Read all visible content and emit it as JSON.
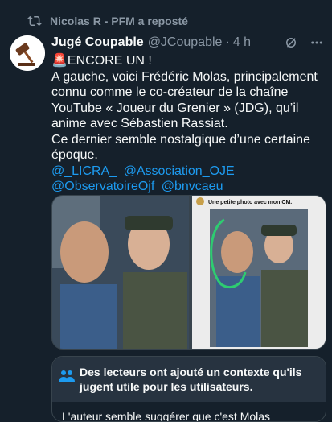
{
  "repost": {
    "text": "Nicolas R - PFM a reposté",
    "icon": "repost-icon"
  },
  "post": {
    "display_name": "Jugé Coupable",
    "handle": "@JCoupable",
    "time": "4 h",
    "siren_emoji": "🚨",
    "paragraph1": "ENCORE UN !",
    "paragraph2": "A gauche, voici Frédéric Molas, principalement connu comme le co-créateur de la chaîne YouTube « Joueur du Grenier » (JDG), qu’il anime avec Sébastien Rassiat.",
    "paragraph3": "Ce dernier semble nostalgique d’une certaine époque.",
    "mentions": [
      "@_LICRA_",
      "@Association_OJE",
      "@ObservatoireOjf",
      "@bnvcaeu"
    ]
  },
  "media": {
    "screenshot_caption": "Une petite photo avec mon CM."
  },
  "community_note": {
    "title": "Des lecteurs ont ajouté un contexte qu'ils jugent utile pour les utilisateurs.",
    "preview": "L'auteur semble suggérer que c'est Molas"
  },
  "colors": {
    "background": "#15202b",
    "text": "#f7f9f9",
    "muted": "#8b98a5",
    "link": "#1d9bf0",
    "note_header": "#273340"
  }
}
